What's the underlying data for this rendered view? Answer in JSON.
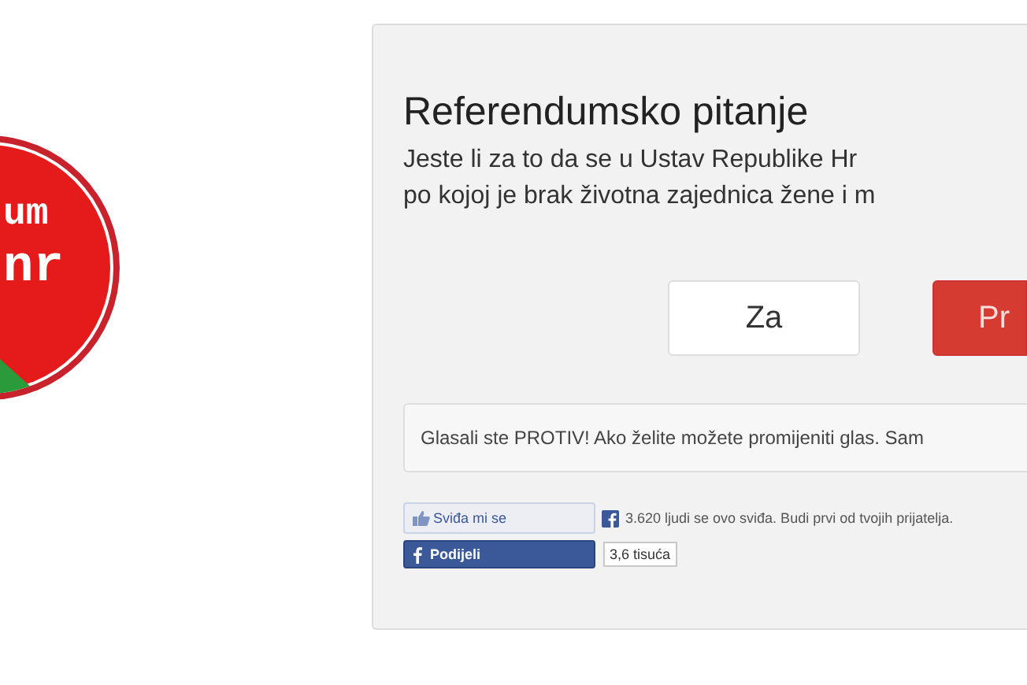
{
  "logo": {
    "lines": [
      "um",
      "nr"
    ]
  },
  "poll": {
    "title": "Referendumsko pitanje",
    "question_lines": [
      "Jeste li za to da se u Ustav Republike Hr",
      "po kojoj je brak životna zajednica žene i m"
    ],
    "options": [
      {
        "label": "Za",
        "selected": false
      },
      {
        "label": "Pr",
        "selected": true
      }
    ],
    "status": "Glasali ste PROTIV! Ako želite možete promijeniti glas. Sam"
  },
  "social": {
    "like_button": "Sviđa mi se",
    "like_text": "3.620 ljudi se ovo sviđa. Budi prvi od tvojih prijatelja.",
    "share_button": "Podijeli",
    "share_count": "3,6 tisuća"
  }
}
